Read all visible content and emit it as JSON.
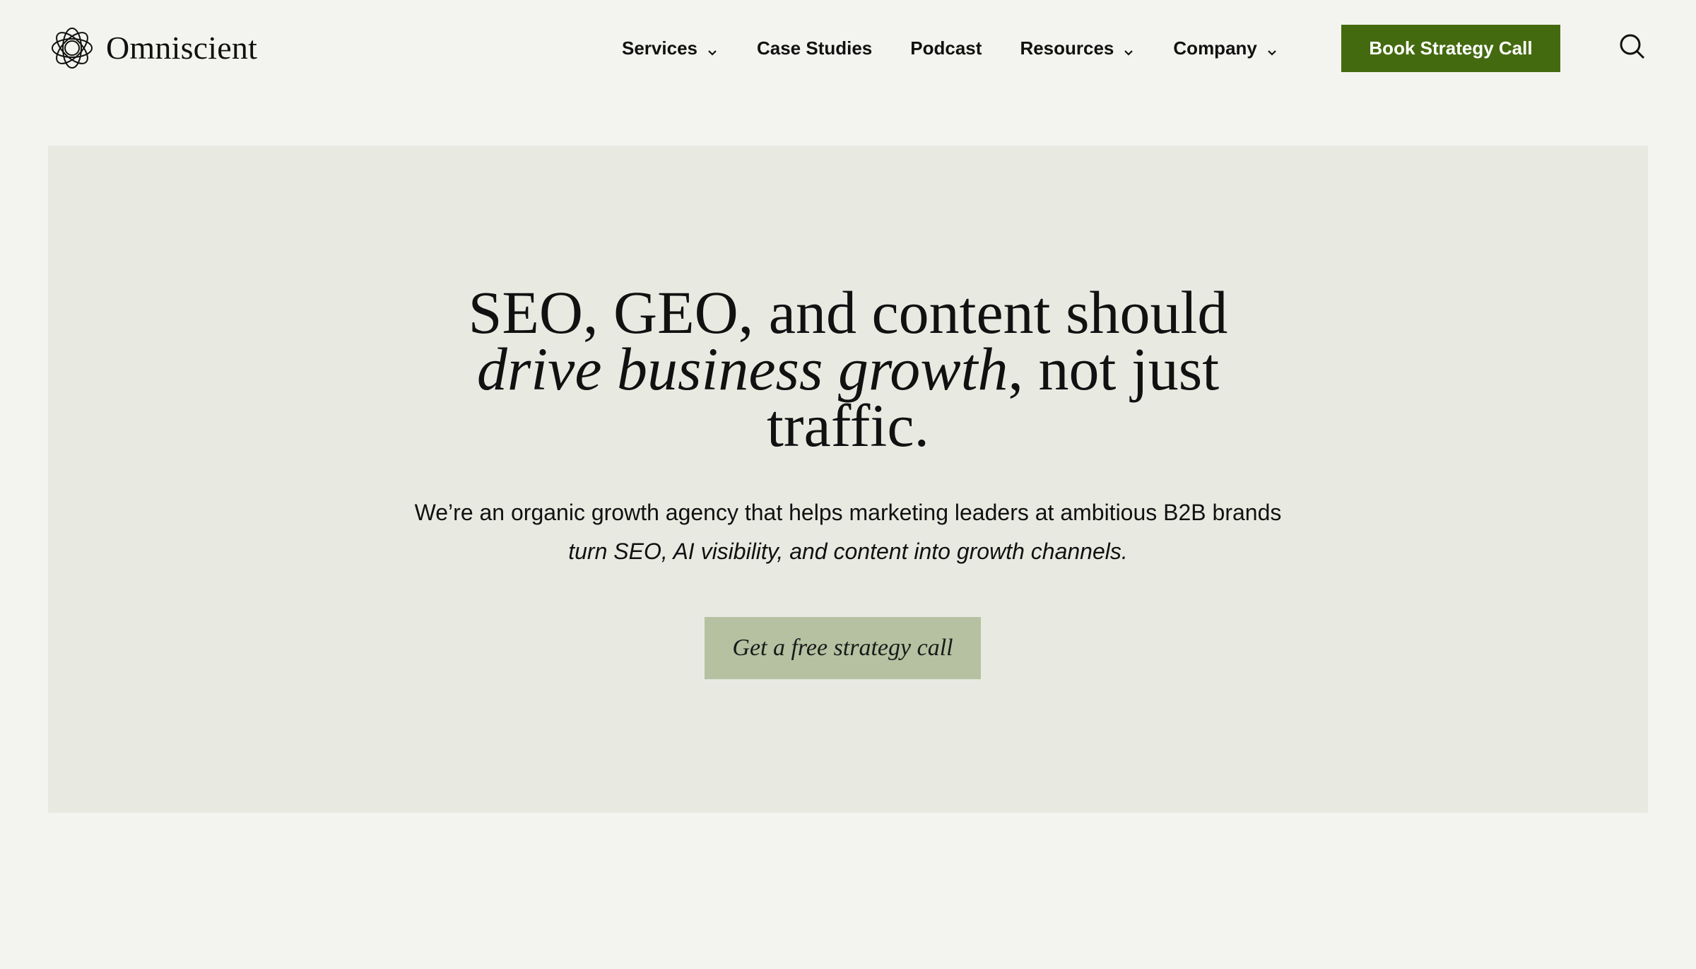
{
  "header": {
    "brand_name": "Omniscient",
    "nav": [
      {
        "label": "Services",
        "has_dropdown": true
      },
      {
        "label": "Case Studies",
        "has_dropdown": false
      },
      {
        "label": "Podcast",
        "has_dropdown": false
      },
      {
        "label": "Resources",
        "has_dropdown": true
      },
      {
        "label": "Company",
        "has_dropdown": true
      }
    ],
    "cta_label": "Book Strategy Call",
    "icons": {
      "logo": "omniscient-logo",
      "search": "search-icon",
      "dropdown": "chevron-down-icon"
    }
  },
  "hero": {
    "title_line1": "SEO, GEO, and content should",
    "title_line2_italic": "drive business growth",
    "title_line2_rest": ", not just",
    "title_line3": "traffic.",
    "subtitle_line1": "We’re an organic growth agency that helps marketing leaders at ambitious B2B brands",
    "subtitle_line2": "turn SEO, AI visibility, and content into growth channels.",
    "cta_label": "Get a free strategy call"
  },
  "colors": {
    "page_background": "#f3f4ef",
    "hero_background": "#e8eae2",
    "primary_button": "#446a0f",
    "secondary_button": "#b5c1a1",
    "text": "#111111"
  }
}
